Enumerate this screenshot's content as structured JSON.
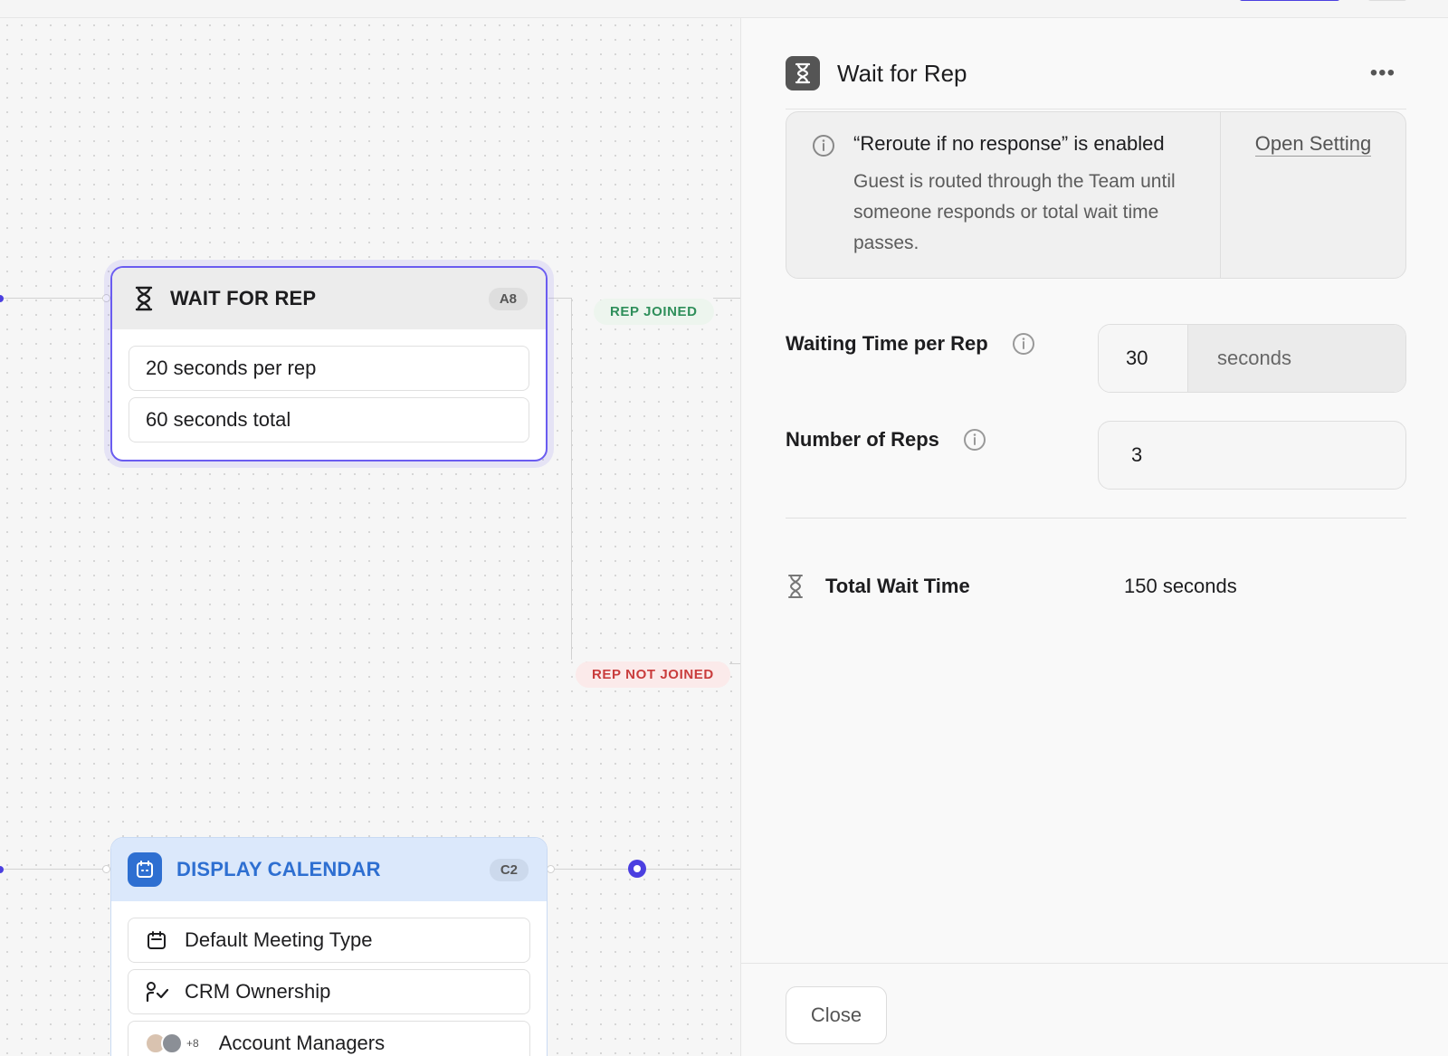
{
  "canvas": {
    "wait_node": {
      "title": "WAIT FOR REP",
      "badge": "A8",
      "rows": [
        "20 seconds per rep",
        "60 seconds total"
      ]
    },
    "calendar_node": {
      "title": "DISPLAY CALENDAR",
      "badge": "C2",
      "rows": {
        "meeting_type": "Default Meeting Type",
        "crm": "CRM Ownership",
        "managers": "Account Managers",
        "managers_more": "+8"
      }
    },
    "edges": {
      "joined": "REP JOINED",
      "not_joined": "REP NOT JOINED"
    }
  },
  "panel": {
    "title": "Wait for Rep",
    "more": "•••",
    "notice": {
      "title": "“Reroute if no response” is enabled",
      "description": "Guest is routed through the Team until someone responds or total wait time passes.",
      "link": "Open Setting"
    },
    "waiting_time": {
      "label": "Waiting Time per Rep",
      "value": "30",
      "unit": "seconds"
    },
    "reps": {
      "label": "Number of Reps",
      "value": "3"
    },
    "total": {
      "label": "Total Wait Time",
      "value": "150 seconds"
    },
    "close_label": "Close"
  },
  "colors": {
    "accent": "#4b3fe0",
    "selection_border": "#6a5cf0",
    "calendar_blue": "#2e6fd1",
    "joined_green": "#2f8f5b",
    "not_joined_red": "#c93c3c"
  }
}
